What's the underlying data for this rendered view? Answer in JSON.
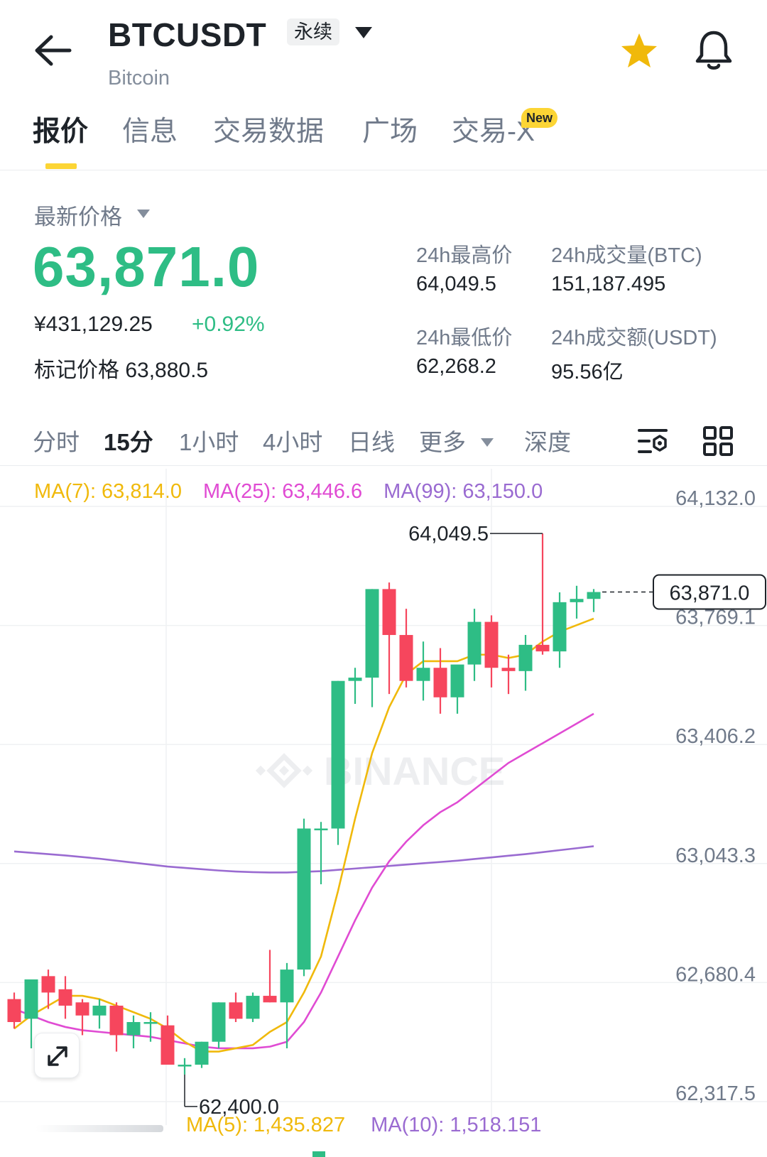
{
  "header": {
    "symbol": "BTCUSDT",
    "contract_type": "永续",
    "name": "Bitcoin"
  },
  "tabs": [
    {
      "label": "报价",
      "active": true
    },
    {
      "label": "信息"
    },
    {
      "label": "交易数据"
    },
    {
      "label": "广场"
    },
    {
      "label": "交易-X",
      "badge": "New"
    }
  ],
  "price": {
    "label": "最新价格",
    "last": "63,871.0",
    "cny": "¥431,129.25",
    "change": "+0.92%",
    "mark_label": "标记价格",
    "mark": "63,880.5"
  },
  "stats": {
    "high_label": "24h最高价",
    "high": "64,049.5",
    "vol_label": "24h成交量(BTC)",
    "vol": "151,187.495",
    "low_label": "24h最低价",
    "low": "62,268.2",
    "turnover_label": "24h成交额(USDT)",
    "turnover": "95.56亿"
  },
  "intervals": [
    {
      "label": "分时"
    },
    {
      "label": "15分",
      "active": true
    },
    {
      "label": "1小时"
    },
    {
      "label": "4小时"
    },
    {
      "label": "日线"
    },
    {
      "label": "更多"
    },
    {
      "label": "深度"
    }
  ],
  "ma_legend": {
    "ma7": "MA(7): 63,814.0",
    "ma25": "MA(25): 63,446.6",
    "ma99": "MA(99): 63,150.0"
  },
  "volume_legend": {
    "ma5": "MA(5): 1,435.827",
    "ma10": "MA(10): 1,518.151"
  },
  "colors": {
    "up": "#2ebd85",
    "down": "#f6465d",
    "ma7": "#f0b90b",
    "ma25": "#e04bd3",
    "ma99": "#9a6bd1",
    "accent": "#fcd535"
  },
  "chart_data": {
    "type": "candlestick",
    "y_axis_ticks": [
      "64,132.0",
      "63,769.1",
      "63,406.2",
      "63,043.3",
      "62,680.4",
      "62,317.5"
    ],
    "ylim": [
      62317.5,
      64132.0
    ],
    "current_price_label": "63,871.0",
    "high_marker": "64,049.5",
    "low_marker": "62,400.0",
    "watermark": "BINANCE",
    "candles": [
      [
        62630,
        62650,
        62540,
        62560
      ],
      [
        62570,
        62690,
        62480,
        62690
      ],
      [
        62700,
        62720,
        62600,
        62650
      ],
      [
        62660,
        62700,
        62570,
        62610
      ],
      [
        62620,
        62630,
        62520,
        62580
      ],
      [
        62580,
        62630,
        62540,
        62610
      ],
      [
        62610,
        62620,
        62470,
        62520
      ],
      [
        62520,
        62580,
        62480,
        62560
      ],
      [
        62560,
        62590,
        62500,
        62560
      ],
      [
        62550,
        62580,
        62460,
        62430
      ],
      [
        62430,
        62450,
        62400,
        62430
      ],
      [
        62430,
        62500,
        62420,
        62500
      ],
      [
        62500,
        62620,
        62480,
        62620
      ],
      [
        62620,
        62650,
        62560,
        62570
      ],
      [
        62570,
        62650,
        62560,
        62640
      ],
      [
        62640,
        62780,
        62620,
        62620
      ],
      [
        62620,
        62740,
        62480,
        62720
      ],
      [
        62720,
        63180,
        62700,
        63150
      ],
      [
        63150,
        63170,
        62980,
        63150
      ],
      [
        63150,
        63600,
        63100,
        63600
      ],
      [
        63600,
        63640,
        63530,
        63610
      ],
      [
        63610,
        63880,
        63520,
        63880
      ],
      [
        63880,
        63900,
        63560,
        63740
      ],
      [
        63740,
        63820,
        63580,
        63600
      ],
      [
        63600,
        63720,
        63540,
        63640
      ],
      [
        63640,
        63700,
        63500,
        63550
      ],
      [
        63550,
        63640,
        63500,
        63650
      ],
      [
        63650,
        63820,
        63600,
        63780
      ],
      [
        63780,
        63800,
        63580,
        63640
      ],
      [
        63640,
        63680,
        63560,
        63630
      ],
      [
        63630,
        63740,
        63570,
        63710
      ],
      [
        63710,
        64049.5,
        63680,
        63690
      ],
      [
        63690,
        63870,
        63640,
        63840
      ],
      [
        63840,
        63890,
        63790,
        63850
      ],
      [
        63850,
        63880,
        63810,
        63871
      ]
    ],
    "ma7": [
      62540,
      62580,
      62610,
      62640,
      62640,
      62630,
      62610,
      62590,
      62570,
      62540,
      62500,
      62470,
      62470,
      62480,
      62490,
      62530,
      62560,
      62650,
      62760,
      62960,
      63180,
      63380,
      63520,
      63620,
      63660,
      63660,
      63660,
      63680,
      63680,
      63670,
      63680,
      63720,
      63750,
      63770,
      63790
    ],
    "ma25": [
      62600,
      62580,
      62560,
      62545,
      62535,
      62530,
      62525,
      62520,
      62515,
      62505,
      62495,
      62485,
      62480,
      62480,
      62480,
      62485,
      62500,
      62560,
      62650,
      62760,
      62870,
      62970,
      63050,
      63110,
      63160,
      63200,
      63230,
      63270,
      63310,
      63350,
      63380,
      63410,
      63440,
      63470,
      63500
    ],
    "ma99": [
      63080,
      63076,
      63072,
      63068,
      63063,
      63058,
      63052,
      63046,
      63040,
      63034,
      63030,
      63026,
      63022,
      63019,
      63017,
      63016,
      63016,
      63018,
      63020,
      63024,
      63028,
      63032,
      63036,
      63040,
      63044,
      63048,
      63052,
      63057,
      63062,
      63067,
      63072,
      63078,
      63084,
      63090,
      63096
    ]
  }
}
